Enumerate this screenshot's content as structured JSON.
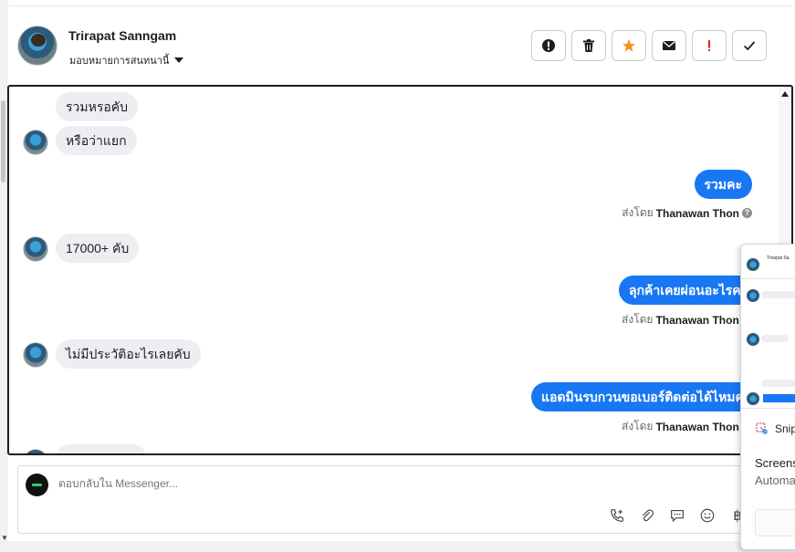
{
  "header": {
    "contact_name": "Trirapat Sanngam",
    "assign_label": "มอบหมายการสนทนานี้"
  },
  "actions": [
    {
      "icon": "alert-circle-icon"
    },
    {
      "icon": "trash-icon"
    },
    {
      "icon": "star-icon",
      "color": "#f7931e"
    },
    {
      "icon": "envelope-icon"
    },
    {
      "icon": "exclamation-icon",
      "color": "#e02020"
    },
    {
      "icon": "check-icon"
    }
  ],
  "messages": {
    "m1": "รวมหรอคับ",
    "m2": "หรือว่าแยก",
    "m3": "รวมคะ",
    "m3_sent_prefix": "ส่งโดย",
    "m3_sender": "Thanawan Thon",
    "m4": "17000+ คับ",
    "m5": "ลุกค้าเคยผ่อนอะไรคะ",
    "m5_sent_prefix": "ส่งโดย",
    "m5_sender": "Thanawan Thon",
    "m6": "ไม่มีประวัติอะไรเลยคับ",
    "m7": "แอดมินรบกวนขอเบอร์ติดต่อได้ไหมคะ",
    "m7_sent_prefix": "ส่งโดย",
    "m7_sender": "Thanawan Thon"
  },
  "reply": {
    "placeholder": "ตอบกลับใน Messenger..."
  },
  "reply_tools": [
    "phone-add-icon",
    "paperclip-icon",
    "chat-bubble-icon",
    "emoji-icon",
    "baht-icon"
  ],
  "overlay": {
    "thumb_title": "Trirapat Sa",
    "snip_label": "Snip",
    "text1": "Screens",
    "text2": "Automa"
  },
  "colors": {
    "accent": "#1877f2",
    "star": "#f7931e",
    "alert": "#e02020"
  }
}
